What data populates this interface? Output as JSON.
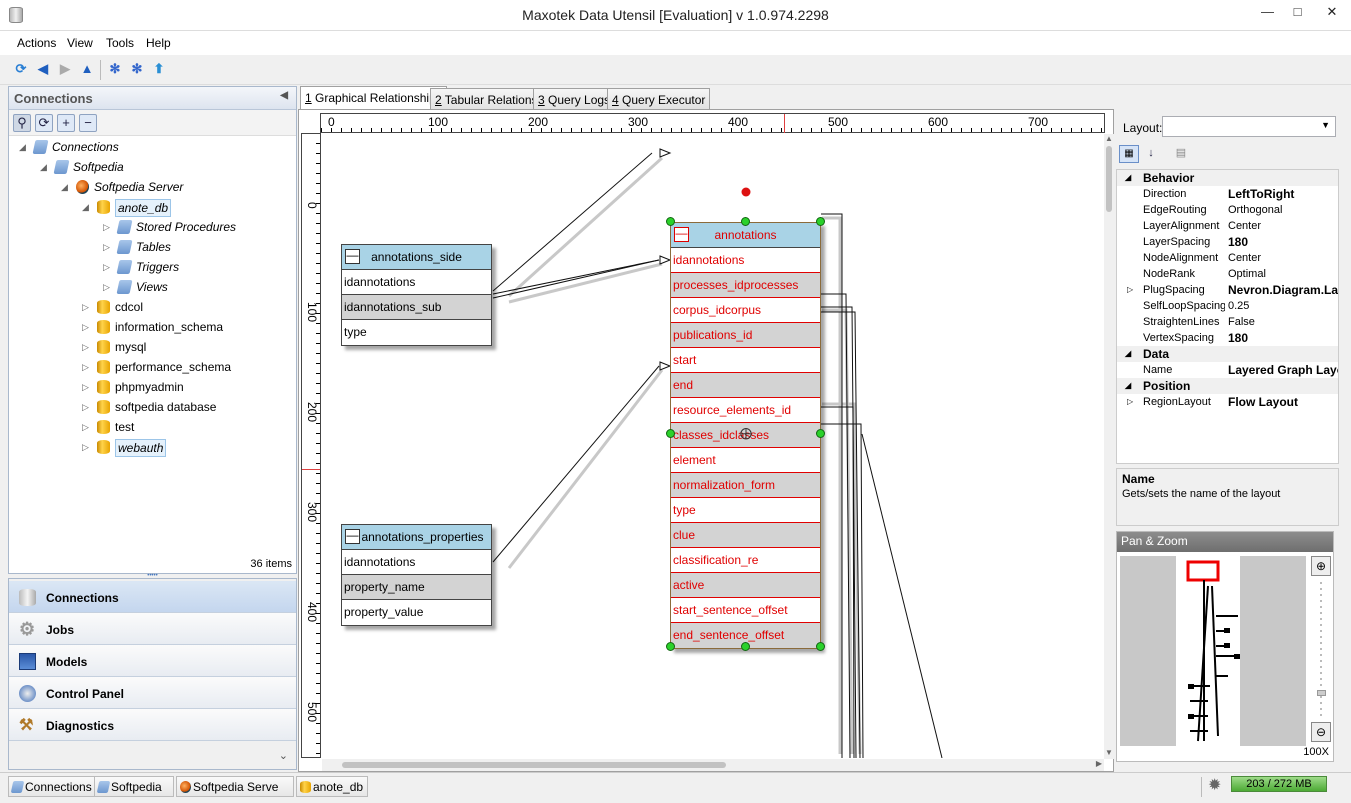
{
  "window": {
    "title": "Maxotek Data Utensil [Evaluation] v 1.0.974.2298"
  },
  "menu": [
    "Actions",
    "View",
    "Tools",
    "Help"
  ],
  "left_panel": {
    "title": "Connections",
    "item_count": "36 items",
    "tree": [
      {
        "label": "Connections",
        "italic": true
      },
      {
        "label": "Softpedia",
        "italic": true
      },
      {
        "label": "Softpedia Server",
        "italic": true
      },
      {
        "label": "anote_db",
        "italic": true
      },
      {
        "label": "Stored Procedures",
        "italic": true
      },
      {
        "label": "Tables",
        "italic": true
      },
      {
        "label": "Triggers",
        "italic": true
      },
      {
        "label": "Views",
        "italic": true
      },
      {
        "label": "cdcol"
      },
      {
        "label": "information_schema"
      },
      {
        "label": "mysql"
      },
      {
        "label": "performance_schema"
      },
      {
        "label": "phpmyadmin"
      },
      {
        "label": "softpedia database"
      },
      {
        "label": "test"
      },
      {
        "label": "webauth",
        "italic": true
      }
    ]
  },
  "nav": [
    "Connections",
    "Jobs",
    "Models",
    "Control Panel",
    "Diagnostics"
  ],
  "tabs": [
    {
      "num": "1",
      "label": " Graphical Relationships"
    },
    {
      "num": "2",
      "label": " Tabular Relations"
    },
    {
      "num": "3",
      "label": " Query Logs"
    },
    {
      "num": "4",
      "label": " Query Executor"
    }
  ],
  "ruler": {
    "h": [
      "0",
      "100",
      "200",
      "300",
      "400",
      "500",
      "600",
      "700"
    ],
    "v": [
      "0",
      "100",
      "200",
      "300",
      "400",
      "500"
    ]
  },
  "entities": {
    "side": {
      "title": "annotations_side",
      "fields": [
        "idannotations",
        "idannotations_sub",
        "type"
      ]
    },
    "props": {
      "title": "annotations_properties",
      "fields": [
        "idannotations",
        "property_name",
        "property_value"
      ]
    },
    "main": {
      "title": "annotations",
      "fields": [
        "idannotations",
        "processes_idprocesses",
        "corpus_idcorpus",
        "publications_id",
        "start",
        "end",
        "resource_elements_id",
        "classes_idclasses",
        "element",
        "normalization_form",
        "type",
        "clue",
        "classification_re",
        "active",
        "start_sentence_offset",
        "end_sentence_offset"
      ]
    }
  },
  "properties": {
    "layout_label": "Layout:",
    "categories": [
      {
        "name": "Behavior",
        "rows": [
          {
            "k": "Direction",
            "v": "LeftToRight",
            "bold": true
          },
          {
            "k": "EdgeRouting",
            "v": "Orthogonal"
          },
          {
            "k": "LayerAlignment",
            "v": "Center"
          },
          {
            "k": "LayerSpacing",
            "v": "180",
            "bold": true
          },
          {
            "k": "NodeAlignment",
            "v": "Center"
          },
          {
            "k": "NodeRank",
            "v": "Optimal"
          },
          {
            "k": "PlugSpacing",
            "v": "Nevron.Diagram.Lay",
            "bold": true,
            "expand": true
          },
          {
            "k": "SelfLoopSpacing",
            "v": "0.25"
          },
          {
            "k": "StraightenLines",
            "v": "False"
          },
          {
            "k": "VertexSpacing",
            "v": "180",
            "bold": true
          }
        ]
      },
      {
        "name": "Data",
        "rows": [
          {
            "k": "Name",
            "v": "Layered Graph Layo",
            "bold": true
          }
        ]
      },
      {
        "name": "Position",
        "rows": [
          {
            "k": "RegionLayout",
            "v": "Flow Layout",
            "bold": true,
            "expand": true
          }
        ]
      }
    ],
    "desc_title": "Name",
    "desc_text": "Gets/sets the name of the layout"
  },
  "panzoom": {
    "title": "Pan & Zoom",
    "zoom": "100X"
  },
  "status": {
    "crumbs": [
      "Connections",
      "Softpedia",
      "Softpedia Serve",
      "anote_db"
    ],
    "memory": "203 / 272 MB"
  }
}
